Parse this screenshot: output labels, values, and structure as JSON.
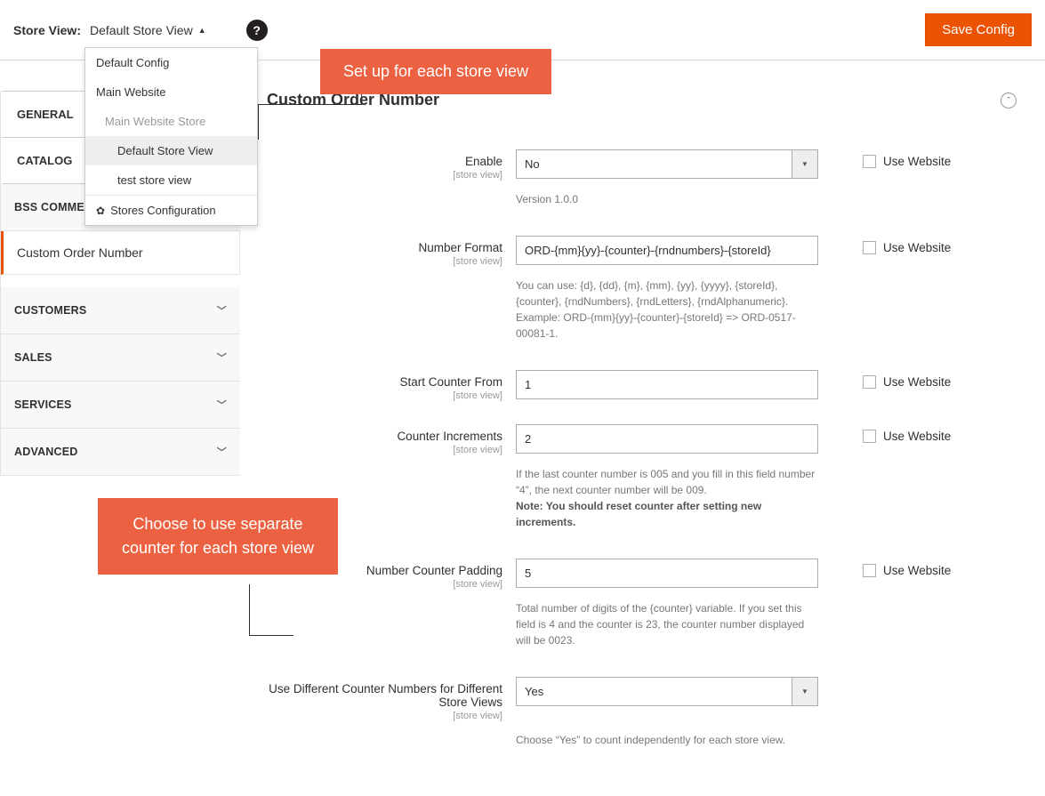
{
  "topbar": {
    "store_view_label": "Store View:",
    "current_store_view": "Default Store View",
    "save_button": "Save Config"
  },
  "store_switcher": {
    "default_config": "Default Config",
    "main_website": "Main Website",
    "main_website_store": "Main Website Store",
    "default_store_view": "Default Store View",
    "test_store_view": "test store view",
    "stores_config": "Stores Configuration"
  },
  "sidebar": {
    "general_tab": "GENERAL",
    "catalog_tab": "CATALOG",
    "bss_section": "BSS COMMERCE",
    "bss_link": "Custom Order Number",
    "customers_section": "CUSTOMERS",
    "sales_section": "SALES",
    "services_section": "SERVICES",
    "advanced_section": "ADVANCED"
  },
  "section": {
    "title": "Custom Order Number"
  },
  "fields": {
    "enable": {
      "label": "Enable",
      "scope": "[store view]",
      "value": "No",
      "note": "Version 1.0.0"
    },
    "number_format": {
      "label": "Number Format",
      "scope": "[store view]",
      "value": "ORD-{mm}{yy}-{counter}-{rndnumbers}-{storeId}",
      "note": "You can use: {d}, {dd}, {m}, {mm}, {yy}, {yyyy}, {storeId}, {counter}, {rndNumbers}, {rndLetters}, {rndAlphanumeric}. Example: ORD-{mm}{yy}-{counter}-{storeId} => ORD-0517-00081-1."
    },
    "start_counter": {
      "label": "Start Counter From",
      "scope": "[store view]",
      "value": "1"
    },
    "counter_increments": {
      "label": "Counter Increments",
      "scope": "[store view]",
      "value": "2",
      "note_pre": "If the last counter number is 005 and you fill in this field number “4”, the next counter number will be 009.",
      "note_bold": "Note",
      "note_post": ": You should reset counter after setting new increments."
    },
    "padding": {
      "label": "Number Counter Padding",
      "scope": "[store view]",
      "value": "5",
      "note": "Total number of digits of the {counter} variable. If you set this field is 4 and the counter is 23, the counter number displayed will be 0023."
    },
    "diff_counter": {
      "label": "Use Different Counter Numbers for Different Store Views",
      "scope": "[store view]",
      "value": "Yes",
      "note": "Choose “Yes” to count independently for each store view."
    }
  },
  "use_website_label": "Use Website",
  "callouts": {
    "c1": "Set up for each store view",
    "c2": "Choose to use separate counter for each store view"
  }
}
